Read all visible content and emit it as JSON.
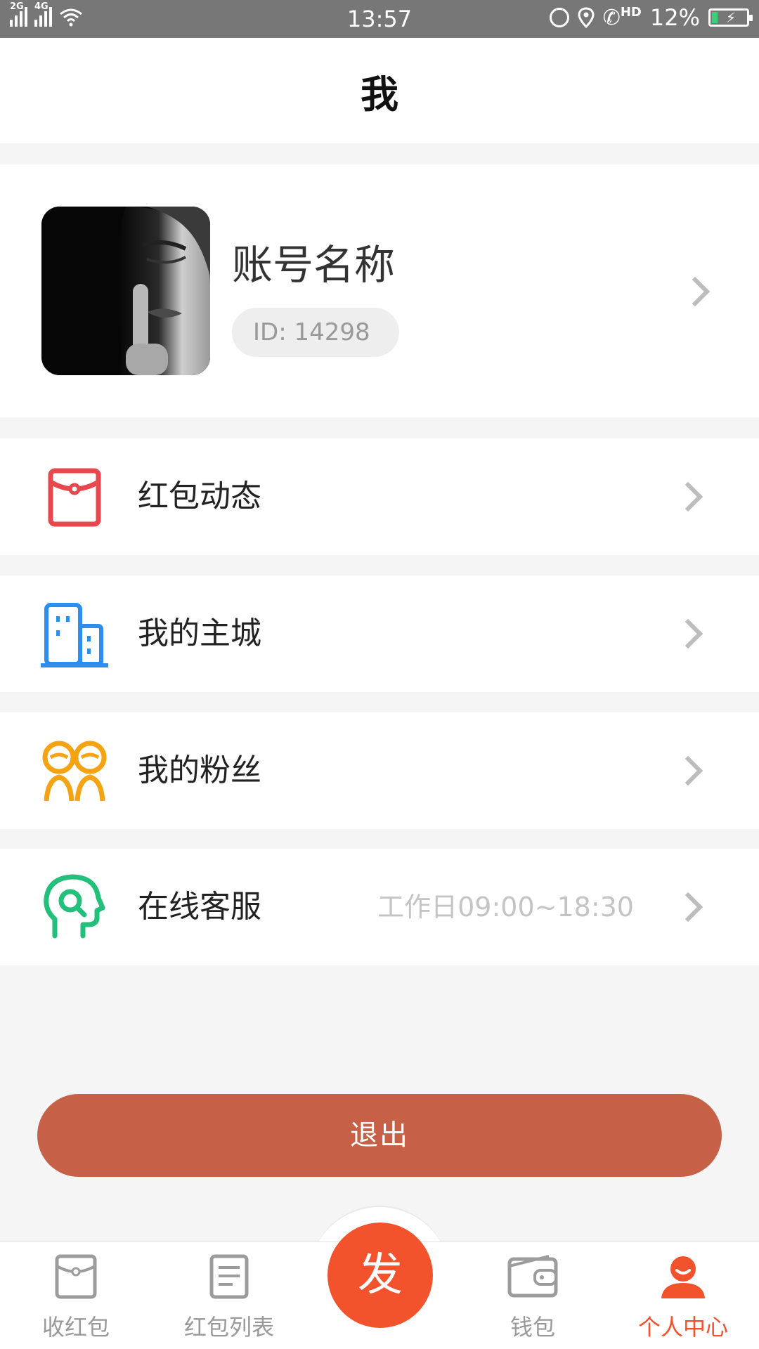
{
  "status_bar": {
    "signal1_label": "2G",
    "signal2_label": "4G",
    "time": "13:57",
    "hd_label": "HD",
    "battery_percent": "12%"
  },
  "header": {
    "title": "我"
  },
  "profile": {
    "name": "账号名称",
    "id_text": "ID: 14298"
  },
  "menu": [
    {
      "label": "红包动态",
      "icon": "red-envelope-icon",
      "color": "#e8474e"
    },
    {
      "label": "我的主城",
      "icon": "building-icon",
      "color": "#2d8ef0"
    },
    {
      "label": "我的粉丝",
      "icon": "fans-icon",
      "color": "#f5a312"
    },
    {
      "label": "在线客服",
      "note": "工作日09:00~18:30",
      "icon": "customer-service-icon",
      "color": "#22c07a"
    }
  ],
  "logout_label": "退出",
  "bottom_nav": {
    "items": [
      {
        "label": "收红包",
        "icon": "red-envelope-outline-icon"
      },
      {
        "label": "红包列表",
        "icon": "list-document-icon"
      },
      {
        "label": "钱包",
        "icon": "wallet-icon"
      },
      {
        "label": "个人中心",
        "icon": "person-icon",
        "active": true
      }
    ],
    "send_label": "发",
    "active_color": "#f2532c",
    "send_color": "#f2532c"
  }
}
